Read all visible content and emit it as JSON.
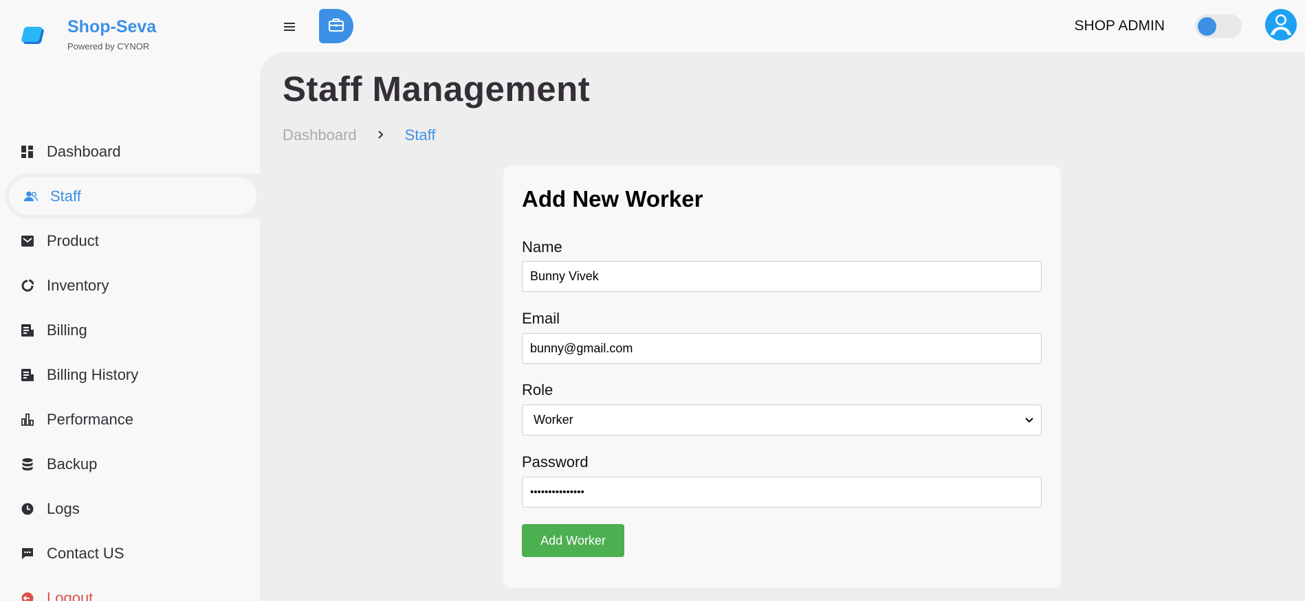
{
  "brand": {
    "name": "Shop-Seva",
    "subtitle": "Powered by CYNOR"
  },
  "sidebar": {
    "items": [
      {
        "label": "Dashboard",
        "icon": "dashboard-icon"
      },
      {
        "label": "Staff",
        "icon": "people-icon",
        "active": true
      },
      {
        "label": "Product",
        "icon": "box-icon"
      },
      {
        "label": "Inventory",
        "icon": "pie-icon"
      },
      {
        "label": "Billing",
        "icon": "receipt-icon"
      },
      {
        "label": "Billing History",
        "icon": "receipt-icon"
      },
      {
        "label": "Performance",
        "icon": "bar-chart-icon"
      },
      {
        "label": "Backup",
        "icon": "database-icon"
      },
      {
        "label": "Logs",
        "icon": "clock-icon"
      },
      {
        "label": "Contact US",
        "icon": "message-icon"
      },
      {
        "label": "Logout",
        "icon": "logout-icon"
      }
    ]
  },
  "topnav": {
    "role_label": "SHOP ADMIN",
    "theme_toggle_on": false
  },
  "main": {
    "title": "Staff Management",
    "breadcrumb": {
      "home": "Dashboard",
      "current": "Staff"
    }
  },
  "form": {
    "title": "Add New Worker",
    "name_label": "Name",
    "name_value": "Bunny Vivek",
    "email_label": "Email",
    "email_value": "bunny@gmail.com",
    "role_label": "Role",
    "role_value": "Worker",
    "password_label": "Password",
    "password_value": "•••••••••••••••",
    "submit_label": "Add Worker"
  },
  "colors": {
    "accent": "#3c91e6",
    "danger": "#db504a",
    "success": "#4caf50"
  }
}
